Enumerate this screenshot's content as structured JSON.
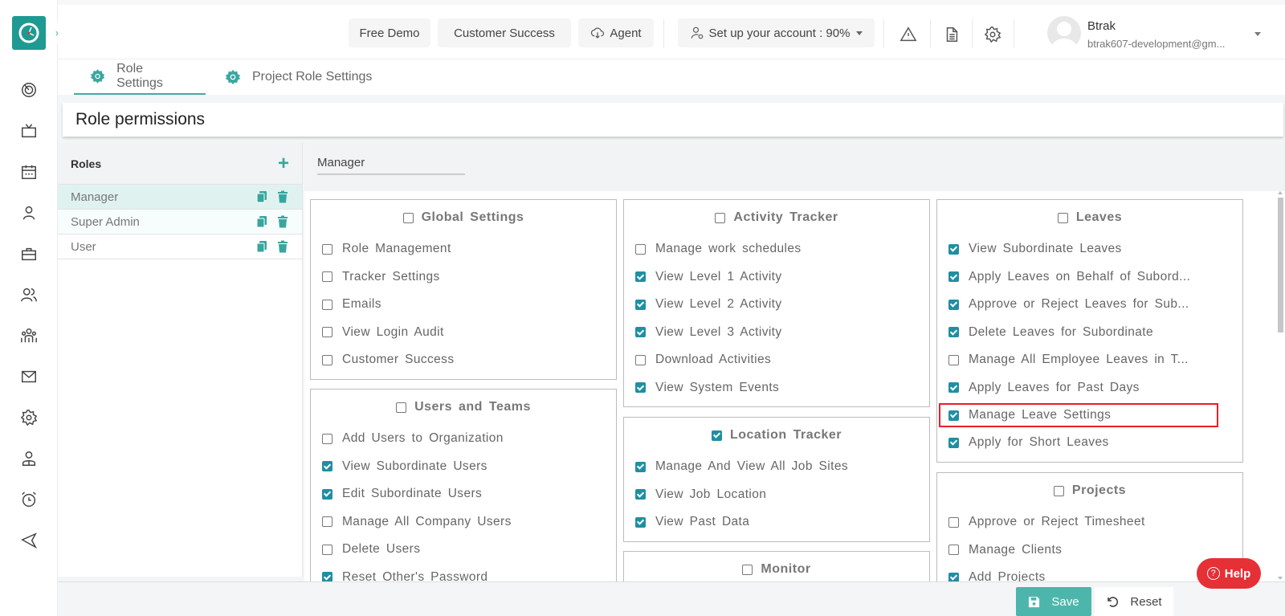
{
  "header": {
    "chips": {
      "free_demo": "Free Demo",
      "customer_success": "Customer Success",
      "agent": "Agent",
      "setup": "Set up your account : 90%"
    },
    "user": {
      "name": "Btrak",
      "email": "btrak607-development@gm..."
    }
  },
  "sidebar": {
    "items": [
      {
        "icon": "dashboard-icon"
      },
      {
        "icon": "tv-icon"
      },
      {
        "icon": "calendar-icon"
      },
      {
        "icon": "user-icon"
      },
      {
        "icon": "briefcase-icon"
      },
      {
        "icon": "users-icon"
      },
      {
        "icon": "team-icon"
      },
      {
        "icon": "mail-icon"
      },
      {
        "icon": "settings-icon"
      },
      {
        "icon": "profile-icon"
      },
      {
        "icon": "alarm-icon"
      },
      {
        "icon": "send-icon"
      }
    ]
  },
  "tabs": [
    {
      "label": "Role Settings",
      "active": true
    },
    {
      "label": "Project Role Settings",
      "active": false
    }
  ],
  "page_title": "Role permissions",
  "roles_panel": {
    "header": "Roles",
    "roles": [
      {
        "name": "Manager",
        "selected": true
      },
      {
        "name": "Super Admin",
        "selected": false
      },
      {
        "name": "User",
        "selected": false
      }
    ]
  },
  "selected_role": "Manager",
  "permission_groups": [
    {
      "title": "Global Settings",
      "checked": false,
      "items": [
        {
          "label": "Role Management",
          "checked": false
        },
        {
          "label": "Tracker Settings",
          "checked": false
        },
        {
          "label": "Emails",
          "checked": false
        },
        {
          "label": "View Login Audit",
          "checked": false
        },
        {
          "label": "Customer Success",
          "checked": false
        }
      ]
    },
    {
      "title": "Users and Teams",
      "checked": false,
      "items": [
        {
          "label": "Add Users to Organization",
          "checked": false
        },
        {
          "label": "View Subordinate Users",
          "checked": true
        },
        {
          "label": "Edit Subordinate Users",
          "checked": true
        },
        {
          "label": "Manage All Company Users",
          "checked": false
        },
        {
          "label": "Delete Users",
          "checked": false
        },
        {
          "label": "Reset Other's Password",
          "checked": true
        }
      ]
    },
    {
      "title": "Activity Tracker",
      "checked": false,
      "items": [
        {
          "label": "Manage work schedules",
          "checked": false
        },
        {
          "label": "View Level 1 Activity",
          "checked": true
        },
        {
          "label": "View Level 2 Activity",
          "checked": true
        },
        {
          "label": "View Level 3 Activity",
          "checked": true
        },
        {
          "label": "Download Activities",
          "checked": false
        },
        {
          "label": "View System Events",
          "checked": true
        }
      ]
    },
    {
      "title": "Location Tracker",
      "checked": true,
      "items": [
        {
          "label": "Manage And View All Job Sites",
          "checked": true
        },
        {
          "label": "View Job Location",
          "checked": true
        },
        {
          "label": "View Past Data",
          "checked": true
        }
      ]
    },
    {
      "title": "Monitor",
      "checked": false,
      "items": []
    },
    {
      "title": "Leaves",
      "checked": false,
      "items": [
        {
          "label": "View Subordinate Leaves",
          "checked": true
        },
        {
          "label": "Apply Leaves on Behalf of Subord...",
          "checked": true
        },
        {
          "label": "Approve or Reject Leaves for Sub...",
          "checked": true
        },
        {
          "label": "Delete Leaves for Subordinate",
          "checked": true
        },
        {
          "label": "Manage All Employee Leaves in T...",
          "checked": false
        },
        {
          "label": "Apply Leaves for Past Days",
          "checked": true
        },
        {
          "label": "Manage Leave Settings",
          "checked": true,
          "highlighted": true
        },
        {
          "label": "Apply for Short Leaves",
          "checked": true
        }
      ]
    },
    {
      "title": "Projects",
      "checked": false,
      "items": [
        {
          "label": "Approve or Reject Timesheet",
          "checked": false
        },
        {
          "label": "Manage Clients",
          "checked": false
        },
        {
          "label": "Add Projects",
          "checked": true
        }
      ]
    }
  ],
  "footer": {
    "save": "Save",
    "reset": "Reset"
  },
  "help": "Help",
  "colors": {
    "brand": "#1f9a92",
    "accent": "#4db6ac",
    "checkbox": "#1f8fa3",
    "highlight": "#e81e25",
    "help": "#e53036"
  }
}
